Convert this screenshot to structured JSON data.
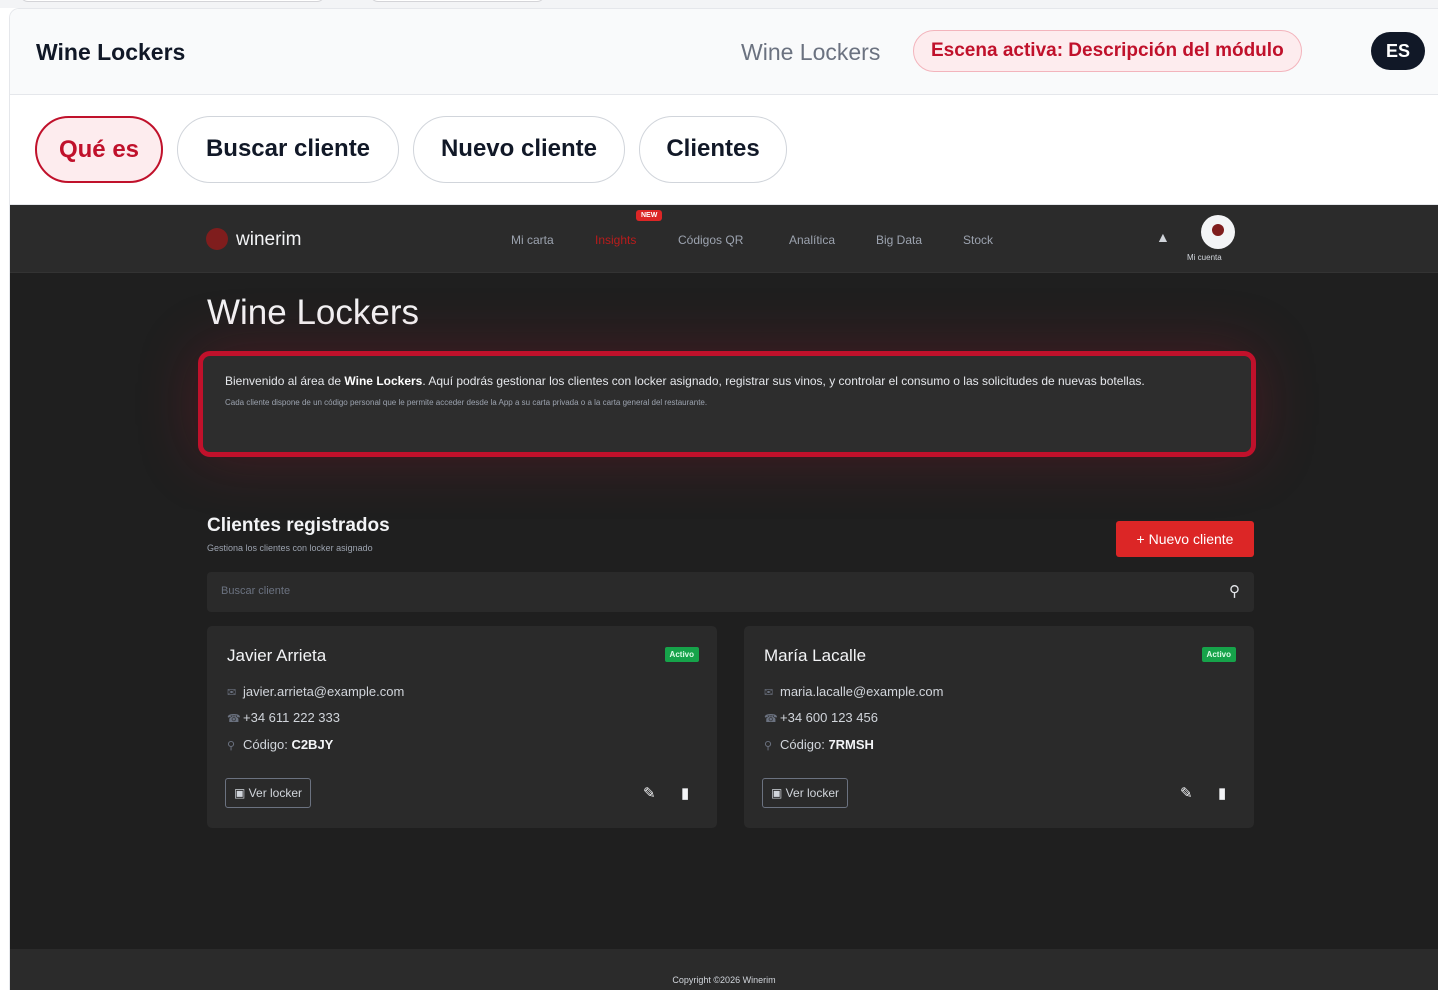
{
  "header": {
    "title": "Wine Lockers",
    "subtitle": "Wine Lockers",
    "scene_badge": "Escena activa: Descripción del módulo",
    "language": "ES"
  },
  "tabs": [
    {
      "label": "Qué es",
      "active": true
    },
    {
      "label": "Buscar cliente",
      "active": false
    },
    {
      "label": "Nuevo cliente",
      "active": false
    },
    {
      "label": "Clientes",
      "active": false
    }
  ],
  "app": {
    "logo": "winerim",
    "nav": [
      "Mi carta",
      "Insights",
      "Códigos QR",
      "Analítica",
      "Big Data",
      "Stock"
    ],
    "nav_badge": "NEW",
    "account_label": "Mi cuenta",
    "page_title": "Wine Lockers",
    "intro": {
      "text_before": "Bienvenido al área de ",
      "text_bold": "Wine Lockers",
      "text_after": ". Aquí podrás gestionar los clientes con locker asignado, registrar sus vinos, y controlar el consumo o las solicitudes de nuevas botellas.",
      "small": "Cada cliente dispone de un código personal que le permite acceder desde la App a su carta privada o a la carta general del restaurante."
    },
    "section_title": "Clientes registrados",
    "section_subtitle": "Gestiona los clientes con locker asignado",
    "new_client_label": "Nuevo cliente",
    "search_placeholder": "Buscar cliente",
    "clients": [
      {
        "name": "Javier Arrieta",
        "status": "Activo",
        "email": "javier.arrieta@example.com",
        "phone": "+34 611 222 333",
        "code_label": "Código:",
        "code": "C2BJY",
        "locker_label": "Ver locker"
      },
      {
        "name": "María Lacalle",
        "status": "Activo",
        "email": "maria.lacalle@example.com",
        "phone": "+34 600 123 456",
        "code_label": "Código:",
        "code": "7RMSH",
        "locker_label": "Ver locker"
      }
    ],
    "footer": "Copyright ©2026 Winerim"
  },
  "colors": {
    "accent": "#c0112b",
    "app_bg": "#1f1f1f",
    "status_green": "#16a34a"
  }
}
